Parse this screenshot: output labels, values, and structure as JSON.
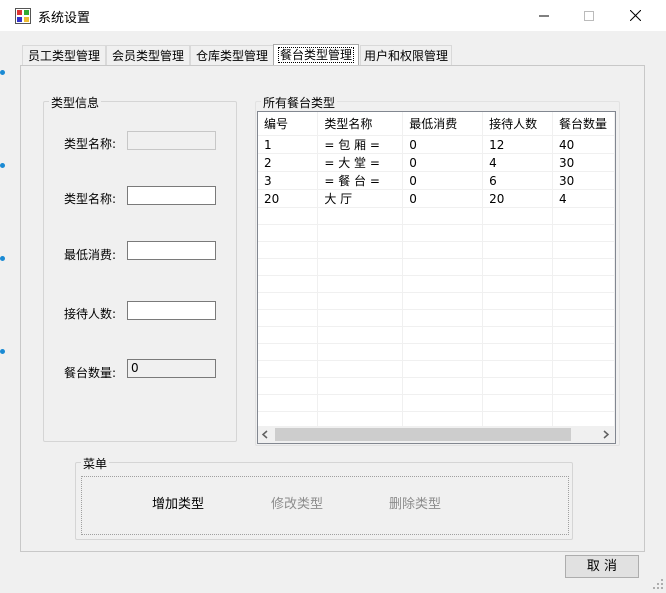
{
  "window": {
    "title": "系统设置"
  },
  "tabs": [
    "员工类型管理",
    "会员类型管理",
    "仓库类型管理",
    "餐台类型管理",
    "用户和权限管理"
  ],
  "type_info": {
    "group_title": "类型信息",
    "fields": [
      {
        "label": "类型名称:",
        "value": ""
      },
      {
        "label": "类型名称:",
        "value": ""
      },
      {
        "label": "最低消费:",
        "value": ""
      },
      {
        "label": "接待人数:",
        "value": ""
      },
      {
        "label": "餐台数量:",
        "value": "0"
      }
    ]
  },
  "all_types": {
    "group_title": "所有餐台类型",
    "columns": [
      "编号",
      "类型名称",
      "最低消费",
      "接待人数",
      "餐台数量"
    ],
    "rows": [
      [
        "1",
        "= 包 厢 =",
        "0",
        "12",
        "40"
      ],
      [
        "2",
        "= 大 堂 =",
        "0",
        "4",
        "30"
      ],
      [
        "3",
        "= 餐 台 =",
        "0",
        "6",
        "30"
      ],
      [
        "20",
        "大 厅",
        "0",
        "20",
        "4"
      ]
    ]
  },
  "menu": {
    "group_title": "菜单",
    "add_label": "增加类型",
    "edit_label": "修改类型",
    "delete_label": "删除类型"
  },
  "footer": {
    "cancel_label": "取 消"
  },
  "colors": {
    "enabled_text": "#000000",
    "disabled_text": "#8c8c8c"
  }
}
